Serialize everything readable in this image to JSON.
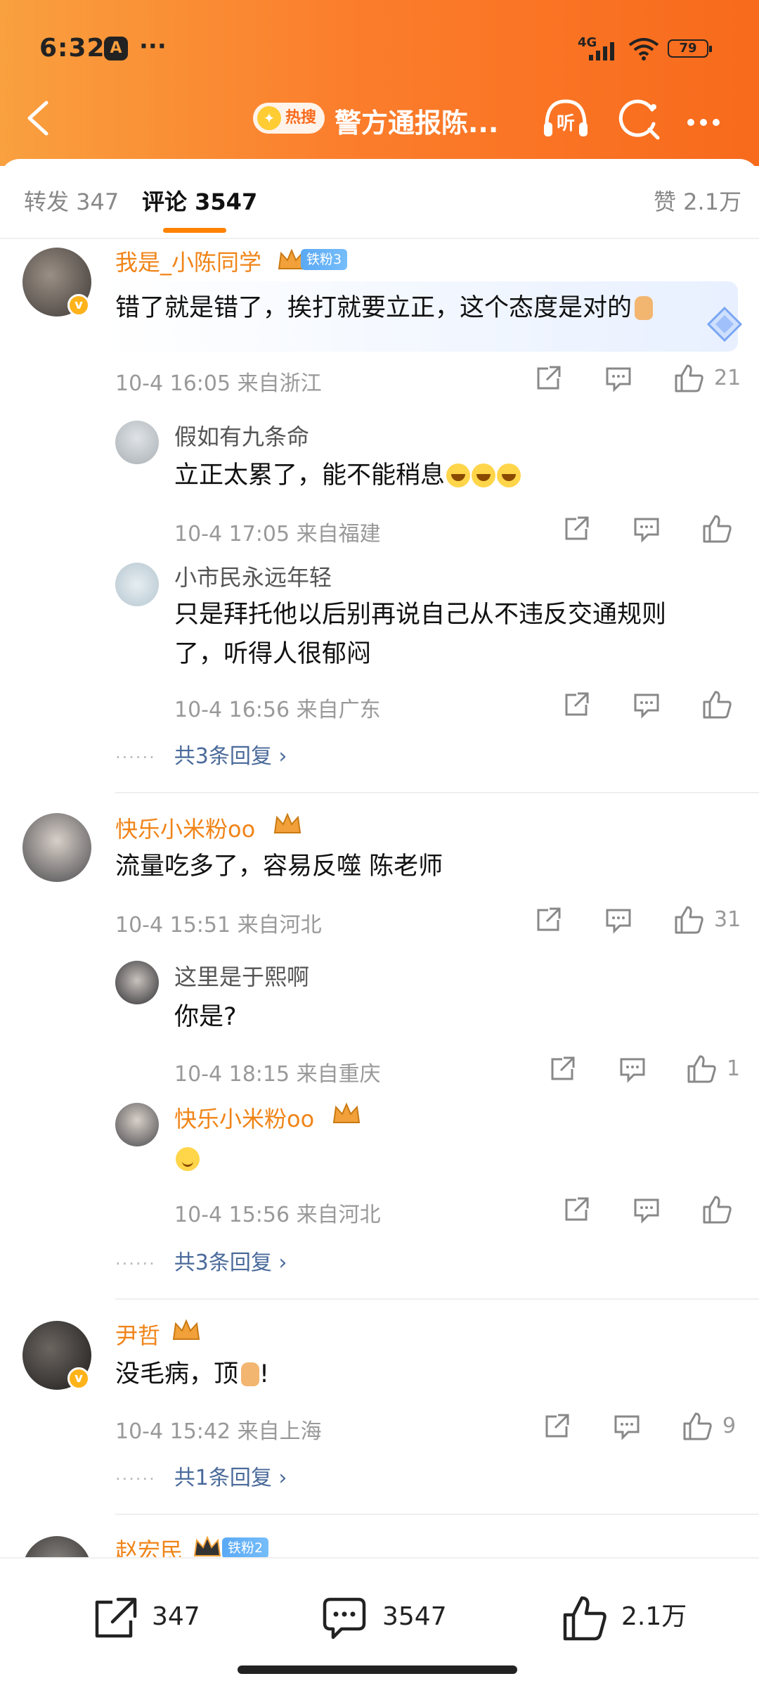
{
  "status_bar": {
    "time": "6:32",
    "dots": "···",
    "network": "4G",
    "battery": "79"
  },
  "nav": {
    "hot_badge": "热搜",
    "title": "警方通报陈...",
    "listen_label": "听"
  },
  "tabs": {
    "repost": "转发 347",
    "comment": "评论 3547",
    "like": "赞 2.1万"
  },
  "comments": [
    {
      "user": "我是_小陈同学",
      "fan_badge": "铁粉3",
      "text": "错了就是错了，挨打就要立正，这个态度是对的",
      "meta": "10-4 16:05  来自浙江",
      "likes": "21",
      "replies": [
        {
          "user": "假如有九条命",
          "text": "立正太累了，能不能稍息",
          "meta": "10-4 17:05  来自福建",
          "likes": ""
        },
        {
          "user": "小市民永远年轻",
          "text_line1": "只是拜托他以后别再说自己从不违反交通规则",
          "text_line2": "了，听得人很郁闷",
          "meta": "10-4 16:56  来自广东",
          "likes": ""
        }
      ],
      "more_replies": "共3条回复 ›"
    },
    {
      "user": "快乐小米粉oo",
      "text": "流量吃多了，容易反噬 陈老师",
      "meta": "10-4 15:51  来自河北",
      "likes": "31",
      "replies": [
        {
          "user": "这里是于熙啊",
          "text": "你是?",
          "meta": "10-4 18:15  来自重庆",
          "likes": "1"
        },
        {
          "user": "快乐小米粉oo",
          "text": "",
          "meta": "10-4 15:56  来自河北",
          "likes": ""
        }
      ],
      "more_replies": "共3条回复 ›"
    },
    {
      "user": "尹哲",
      "text": "没毛病，顶",
      "text_suffix": "!",
      "meta": "10-4 15:42  来自上海",
      "likes": "9",
      "more_replies": "共1条回复 ›"
    },
    {
      "user": "赵宏民",
      "fan_badge": "铁粉2"
    }
  ],
  "bottom_bar": {
    "repost": "347",
    "comment": "3547",
    "like": "2.1万"
  },
  "colors": {
    "accent": "#ff8200",
    "username": "#f08418",
    "link": "#4a6a9a",
    "meta": "#999999"
  }
}
